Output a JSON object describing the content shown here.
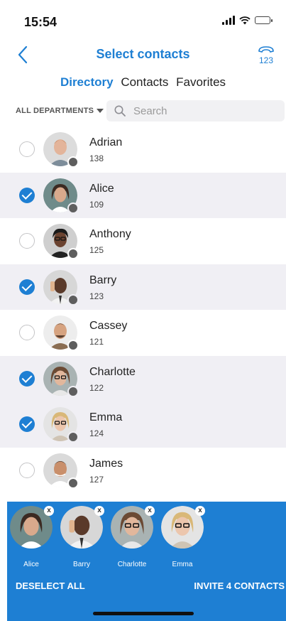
{
  "status_bar": {
    "time": "15:54"
  },
  "nav": {
    "title": "Select contacts",
    "dialpad_label": "123"
  },
  "tabs": [
    {
      "label": "Directory",
      "active": true
    },
    {
      "label": "Contacts",
      "active": false
    },
    {
      "label": "Favorites",
      "active": false
    }
  ],
  "filter": {
    "department": "ALL DEPARTMENTS",
    "search_placeholder": "Search"
  },
  "contacts": [
    {
      "name": "Adrian",
      "ext": "138",
      "selected": false,
      "presence": "offline"
    },
    {
      "name": "Alice",
      "ext": "109",
      "selected": true,
      "presence": "offline"
    },
    {
      "name": "Anthony",
      "ext": "125",
      "selected": false,
      "presence": "offline"
    },
    {
      "name": "Barry",
      "ext": "123",
      "selected": true,
      "presence": "offline"
    },
    {
      "name": "Cassey",
      "ext": "121",
      "selected": false,
      "presence": "offline"
    },
    {
      "name": "Charlotte",
      "ext": "122",
      "selected": true,
      "presence": "offline"
    },
    {
      "name": "Emma",
      "ext": "124",
      "selected": true,
      "presence": "offline"
    },
    {
      "name": "James",
      "ext": "127",
      "selected": false,
      "presence": "offline"
    }
  ],
  "selected_chips": [
    {
      "name": "Alice",
      "remove": "x"
    },
    {
      "name": "Barry",
      "remove": "x"
    },
    {
      "name": "Charlotte",
      "remove": "x"
    },
    {
      "name": "Emma",
      "remove": "x"
    }
  ],
  "actions": {
    "deselect_all": "DESELECT ALL",
    "invite": "INVITE 4 CONTACTS"
  },
  "colors": {
    "accent": "#1e7fd3",
    "selected_row": "#f0eff4",
    "presence_offline": "#5e5e5e"
  }
}
